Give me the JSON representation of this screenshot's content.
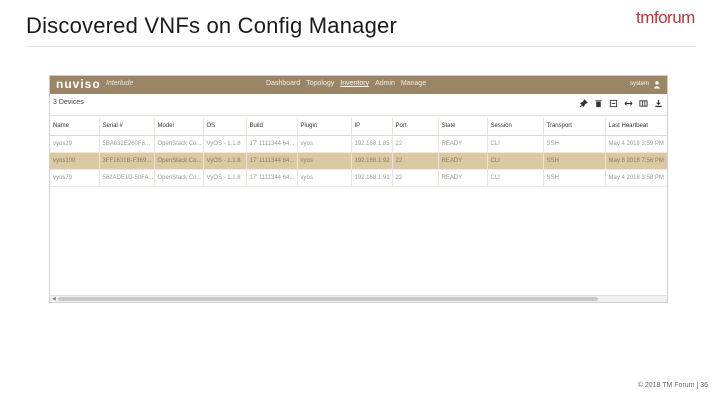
{
  "slide": {
    "title": "Discovered VNFs on Config Manager",
    "logo": "tmforum",
    "footer": "© 2018 TM Forum | 36"
  },
  "app": {
    "brand": "nuviso",
    "brand_sub": "Interlude",
    "nav": [
      "Dashboard",
      "Topology",
      "Inventory",
      "Admin",
      "Manage"
    ],
    "active_nav": "Inventory",
    "user": "system",
    "device_count": "3 Devices",
    "toolbar_icons": [
      "pin-icon",
      "trash-icon",
      "export-icon",
      "expand-icon",
      "columns-icon",
      "download-icon"
    ],
    "accent_color": "#9a8666",
    "selected_row_color": "#dac9a2"
  },
  "table": {
    "columns": [
      "Name",
      "Serial #",
      "Model",
      "OS",
      "Build",
      "Plugin",
      "IP",
      "Port",
      "State",
      "Session",
      "Transport",
      "Last Heartbeat"
    ],
    "rows": [
      [
        "vyos29",
        "5BA632E260F8...",
        "OpenStack Co...",
        "VyOS - 1.1.8",
        "17' 1111344 64...",
        "vyos",
        "192.168.1.85",
        "22",
        "READY",
        "CLI",
        "SSH",
        "May 4 2018 3:59 PM"
      ],
      [
        "vyos100",
        "3FF1631B-F369...",
        "OpenStack Co...",
        "VyOS - 1.1.8",
        "17' 1111344 64...",
        "vyos",
        "192.168.1.92",
        "22",
        "READY",
        "CLI",
        "SSH",
        "May 8 2018 7:56 PM"
      ],
      [
        "vyos79",
        "562ADE1D-50FA...",
        "OpenStack Co...",
        "VyOS - 1.1.8",
        "17' 1111344 64...",
        "vyos",
        "192.168.1.91",
        "22",
        "READY",
        "CLI",
        "SSH",
        "May 4 2018 3:58 PM"
      ]
    ],
    "selected_row": 1
  }
}
